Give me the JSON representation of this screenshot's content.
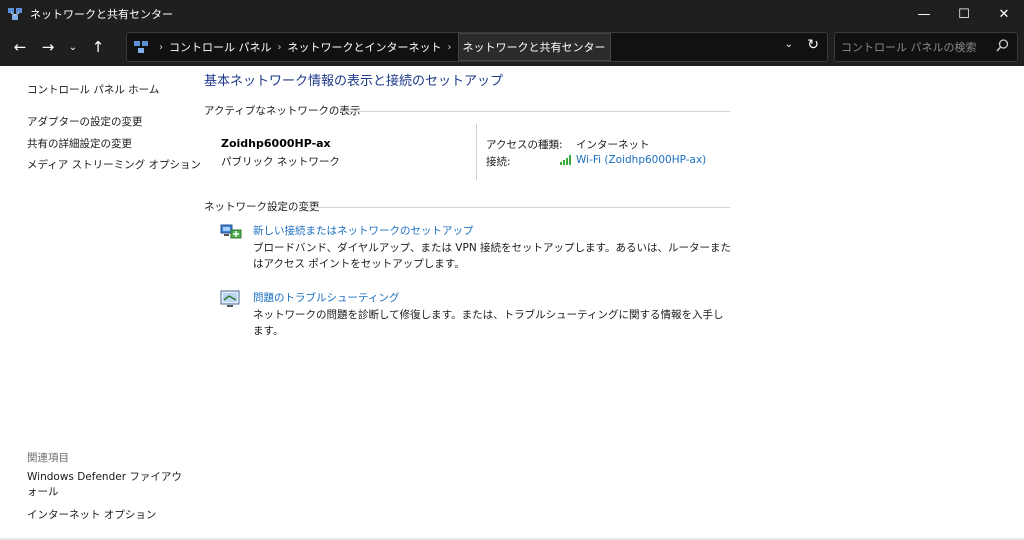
{
  "window": {
    "title": "ネットワークと共有センター",
    "controls": {
      "minimize": "—",
      "maximize": "☐",
      "close": "✕"
    }
  },
  "nav": {
    "back": "←",
    "forward": "→",
    "recent": "⌄",
    "up": "↑",
    "breadcrumbs": [
      "コントロール パネル",
      "ネットワークとインターネット",
      "ネットワークと共有センター"
    ],
    "separator": "›",
    "dropdown": "⌄",
    "refresh": "↻"
  },
  "search": {
    "placeholder": "コントロール パネルの検索"
  },
  "sidebar": {
    "home": "コントロール パネル ホーム",
    "items": [
      {
        "label": "アダプターの設定の変更"
      },
      {
        "label": "共有の詳細設定の変更"
      },
      {
        "label": "メディア ストリーミング オプション"
      }
    ],
    "related_heading": "関連項目",
    "related": [
      {
        "label": "Windows Defender ファイアウォール"
      },
      {
        "label": "インターネット オプション"
      }
    ]
  },
  "main": {
    "title": "基本ネットワーク情報の表示と接続のセットアップ",
    "active_heading": "アクティブなネットワークの表示",
    "network": {
      "name": "Zoidhp6000HP-ax",
      "type": "パブリック ネットワーク",
      "access_label": "アクセスの種類:",
      "access_value": "インターネット",
      "connection_label": "接続:",
      "connection_value": "Wi-Fi (Zoidhp6000HP-ax)"
    },
    "change_heading": "ネットワーク設定の変更",
    "tasks": [
      {
        "title": "新しい接続またはネットワークのセットアップ",
        "description": "ブロードバンド、ダイヤルアップ、または VPN 接続をセットアップします。あるいは、ルーターまたはアクセス ポイントをセットアップします。"
      },
      {
        "title": "問題のトラブルシューティング",
        "description": "ネットワークの問題を診断して修復します。または、トラブルシューティングに関する情報を入手します。"
      }
    ]
  },
  "colors": {
    "titlebar_bg": "#1f1f1f",
    "link": "#1a6fc1",
    "heading": "#1e3a8a",
    "signal": "#3aa83a"
  }
}
